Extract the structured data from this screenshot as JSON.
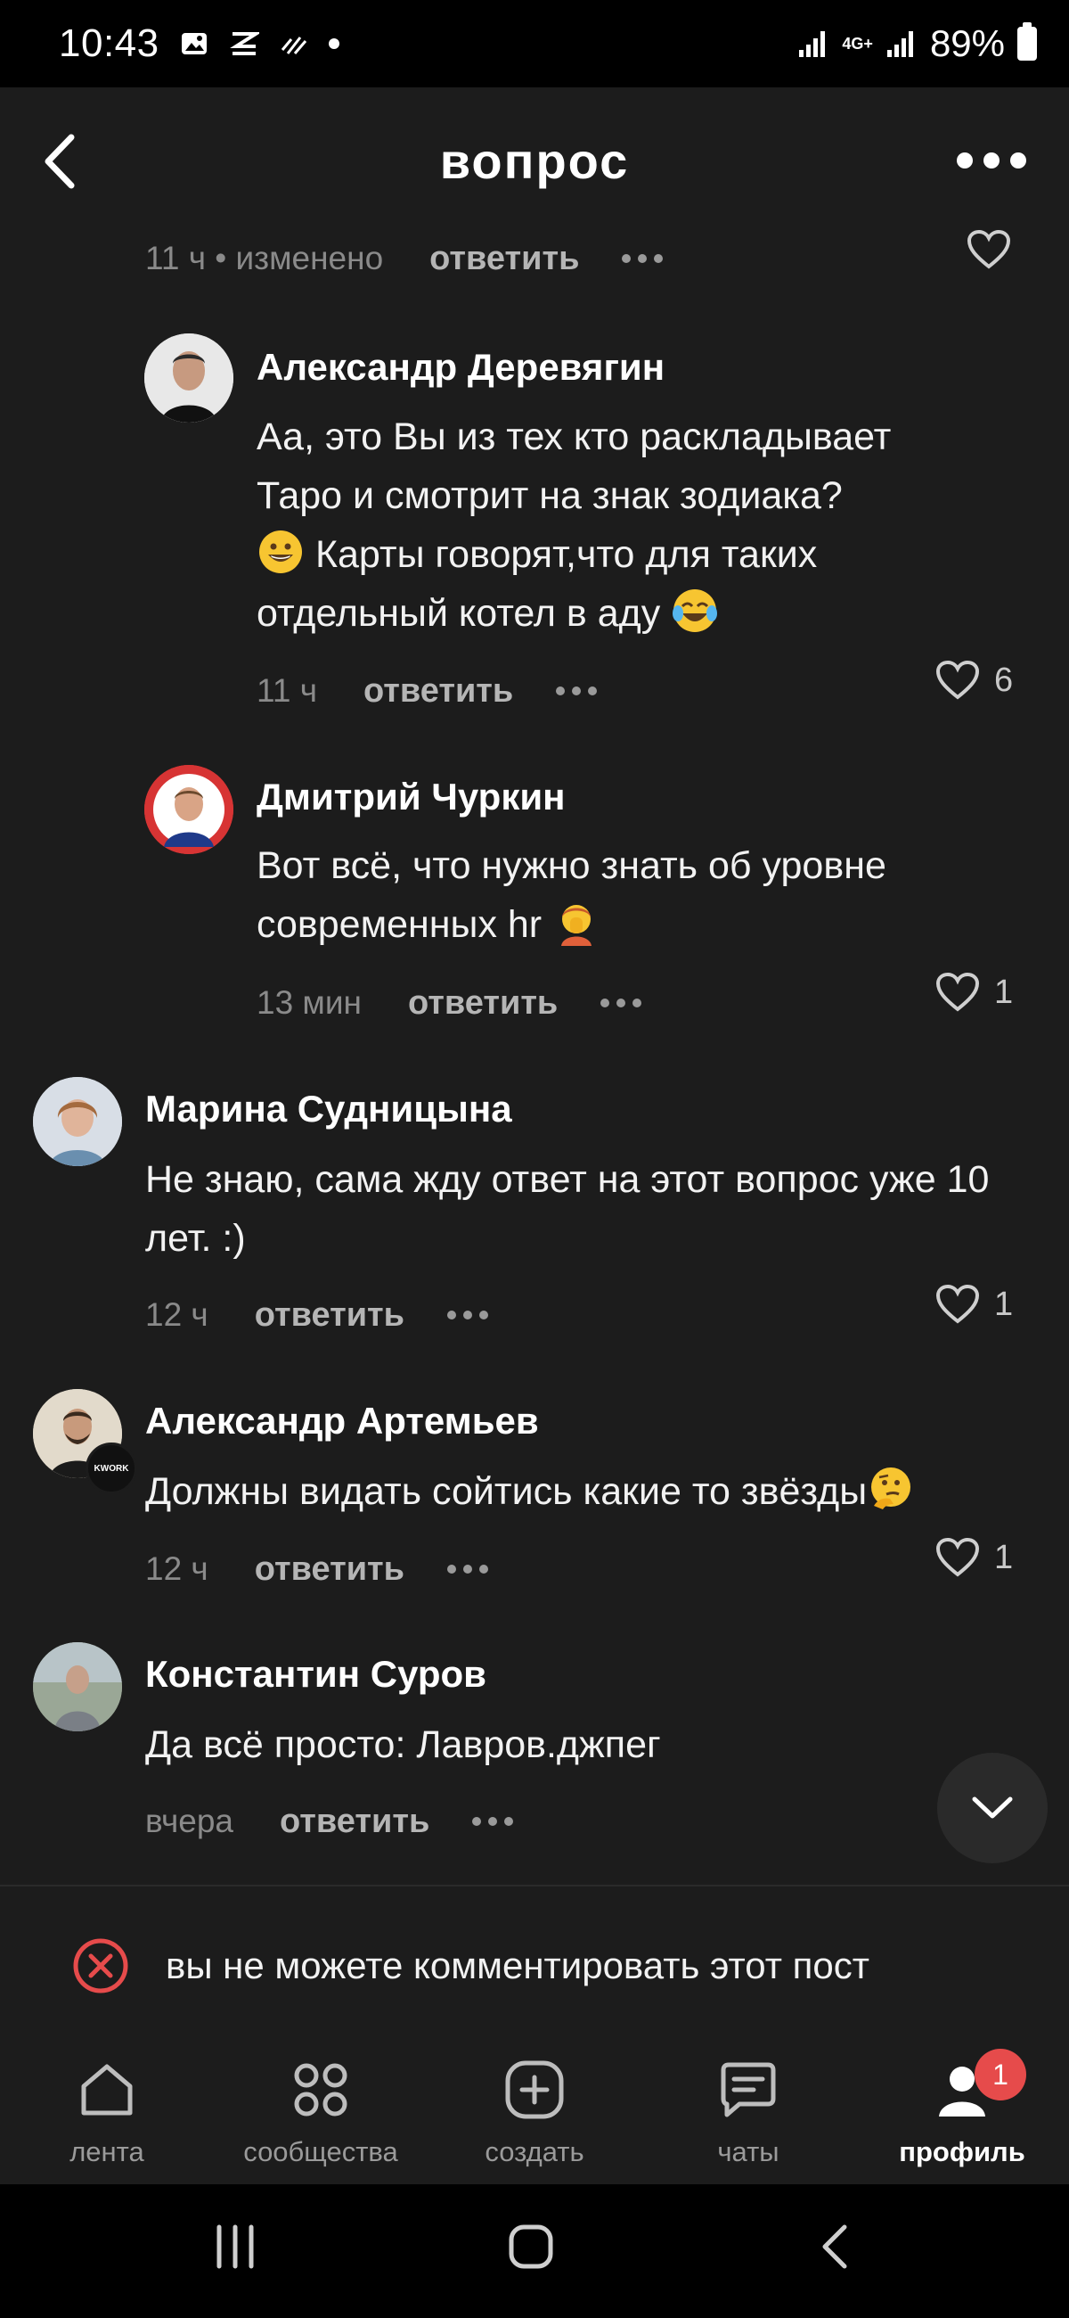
{
  "status_bar": {
    "time": "10:43",
    "network": "4G+",
    "battery": "89%"
  },
  "header": {
    "title": "вопрос"
  },
  "top_meta": {
    "time": "11 ч • изменено",
    "reply": "ответить"
  },
  "comments": [
    {
      "author": "Александр Деревягин",
      "text_1": "Аа, это Вы из тех кто раскладывает Таро и смотрит на знак зодиака?",
      "emoji_1": "grinning-face",
      "text_2": " Карты говорят,что для таких отдельный котел в аду ",
      "emoji_2": "tears-of-joy",
      "time": "11 ч",
      "reply": "ответить",
      "likes": "6"
    },
    {
      "author": "Дмитрий Чуркин",
      "text_1": "Вот всё, что нужно знать об уровне современных hr ",
      "emoji_1": "facepalm",
      "time": "13 мин",
      "reply": "ответить",
      "likes": "1"
    },
    {
      "author": "Марина Судницына",
      "text_1": "Не знаю, сама жду ответ на этот вопрос уже 10 лет. :)",
      "time": "12 ч",
      "reply": "ответить",
      "likes": "1"
    },
    {
      "author": "Александр Артемьев",
      "badge": "KWORK",
      "text_1": "Должны видать сойтись какие то звёзды",
      "emoji_1": "thinking-face",
      "time": "12 ч",
      "reply": "ответить",
      "likes": "1"
    },
    {
      "author": "Константин Суров",
      "text_1": "Да всё просто: Лавров.джпег",
      "time": "вчера",
      "reply": "ответить"
    }
  ],
  "notice": {
    "text": "вы не можете комментировать этот пост",
    "icon": "x-circle-icon",
    "color": "#e64b4b"
  },
  "bottom_nav": {
    "items": [
      {
        "label": "лента",
        "icon": "home-icon"
      },
      {
        "label": "сообщества",
        "icon": "grid-icon"
      },
      {
        "label": "создать",
        "icon": "plus-square-icon"
      },
      {
        "label": "чаты",
        "icon": "chat-icon"
      },
      {
        "label": "профиль",
        "icon": "profile-icon",
        "badge": "1",
        "active": true
      }
    ]
  }
}
